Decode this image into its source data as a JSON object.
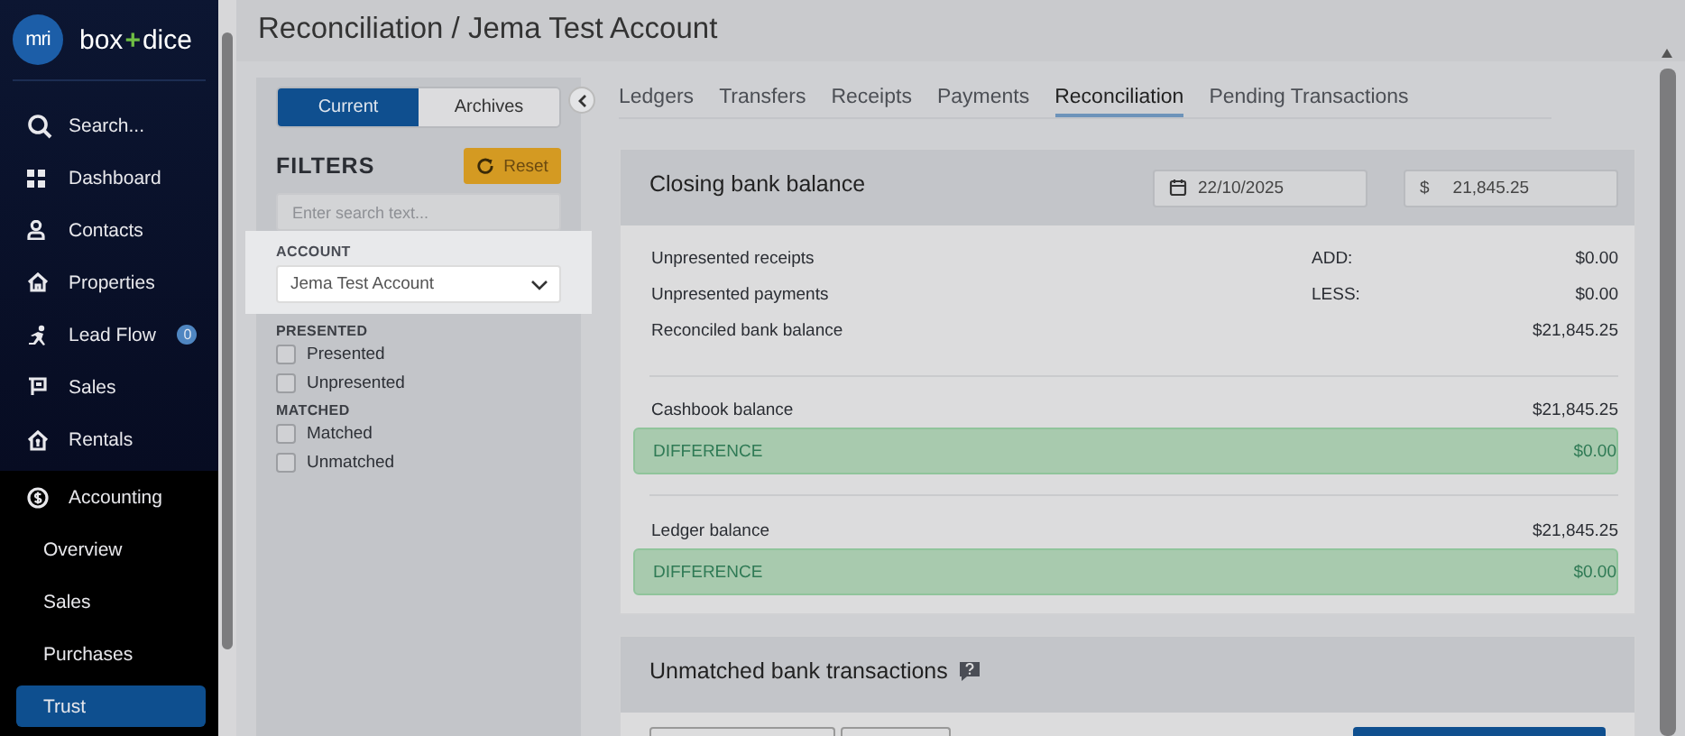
{
  "sidebar": {
    "logo_mark": "mri",
    "brand": [
      "box",
      "+",
      "dice"
    ],
    "items": [
      {
        "label": "Search...",
        "kind": "search",
        "selected": false
      },
      {
        "label": "Dashboard",
        "kind": "nav",
        "selected": false
      },
      {
        "label": "Contacts",
        "kind": "nav",
        "selected": false
      },
      {
        "label": "Properties",
        "kind": "nav",
        "selected": false
      },
      {
        "label": "Lead Flow",
        "kind": "nav",
        "badge": "0",
        "selected": false
      },
      {
        "label": "Sales",
        "kind": "nav",
        "selected": false
      },
      {
        "label": "Rentals",
        "kind": "nav",
        "selected": false
      },
      {
        "label": "Accounting",
        "kind": "section",
        "selected": false
      },
      {
        "label": "Overview",
        "kind": "sub",
        "selected": false
      },
      {
        "label": "Sales",
        "kind": "sub",
        "selected": false
      },
      {
        "label": "Purchases",
        "kind": "sub",
        "selected": false
      },
      {
        "label": "Trust",
        "kind": "sub",
        "selected": true
      }
    ]
  },
  "page": {
    "title": "Reconciliation / Jema Test Account"
  },
  "filters": {
    "views": [
      {
        "label": "Current",
        "selected": true
      },
      {
        "label": "Archives",
        "selected": false
      }
    ],
    "heading": "FILTERS",
    "reset": "Reset",
    "search": {
      "placeholder": "Enter search text..."
    },
    "account": {
      "label": "ACCOUNT",
      "value": "Jema Test Account"
    },
    "groups": [
      {
        "label": "PRESENTED",
        "options": [
          {
            "label": "Presented",
            "checked": false
          },
          {
            "label": "Unpresented",
            "checked": false
          }
        ]
      },
      {
        "label": "MATCHED",
        "options": [
          {
            "label": "Matched",
            "checked": false
          },
          {
            "label": "Unmatched",
            "checked": false
          }
        ]
      }
    ]
  },
  "tabs": [
    {
      "label": "Ledgers",
      "selected": false
    },
    {
      "label": "Transfers",
      "selected": false
    },
    {
      "label": "Receipts",
      "selected": false
    },
    {
      "label": "Payments",
      "selected": false
    },
    {
      "label": "Reconciliation",
      "selected": true
    },
    {
      "label": "Pending Transactions",
      "selected": false
    }
  ],
  "closing": {
    "title": "Closing bank balance",
    "date": "22/10/2025",
    "currency": "$",
    "amount": "21,845.25",
    "sections": [
      {
        "rows": [
          {
            "kind": "line",
            "label": "Unpresented receipts",
            "operator": "ADD:",
            "value": "$0.00"
          },
          {
            "kind": "line",
            "label": "Unpresented payments",
            "operator": "LESS:",
            "value": "$0.00"
          },
          {
            "kind": "line",
            "label": "Reconciled bank balance",
            "value": "$21,845.25"
          }
        ]
      },
      {
        "rows": [
          {
            "kind": "line",
            "label": "Cashbook balance",
            "value": "$21,845.25"
          },
          {
            "kind": "difference",
            "label": "DIFFERENCE",
            "value": "$0.00"
          }
        ]
      },
      {
        "rows": [
          {
            "kind": "line",
            "label": "Ledger balance",
            "value": "$21,845.25"
          },
          {
            "kind": "difference",
            "label": "DIFFERENCE",
            "value": "$0.00"
          }
        ]
      }
    ]
  },
  "unmatched": {
    "title": "Unmatched bank transactions"
  }
}
